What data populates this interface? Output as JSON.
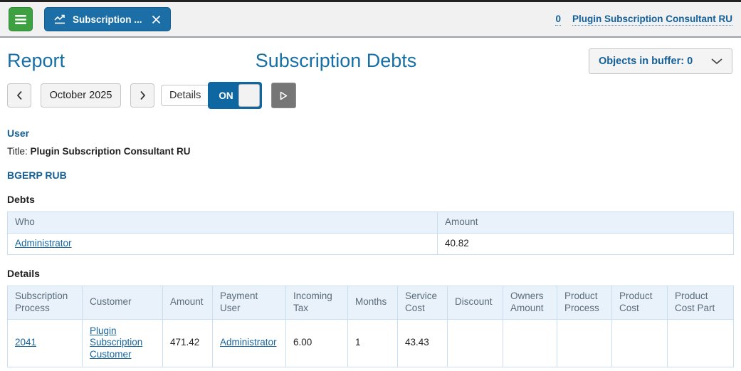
{
  "topbar": {
    "tab_label": "Subscription ...",
    "buffer_link": "0",
    "user_link": "Plugin Subscription Consultant RU"
  },
  "header": {
    "page_title": "Report",
    "report_title": "Subscription Debts",
    "buffer_button_label": "Objects in buffer: 0"
  },
  "toolbar": {
    "month_label": "October 2025",
    "details_label": "Details",
    "toggle_state": "ON"
  },
  "user_section": {
    "heading": "User",
    "title_label": "Title:",
    "title_value": "Plugin Subscription Consultant RU",
    "account_heading": "BGERP RUB"
  },
  "debts": {
    "heading": "Debts",
    "headers": [
      "Who",
      "Amount"
    ],
    "rows": [
      [
        "Administrator",
        "40.82"
      ]
    ]
  },
  "details": {
    "heading": "Details",
    "headers": [
      "Subscription Process",
      "Customer",
      "Amount",
      "Payment User",
      "Incoming Tax",
      "Months",
      "Service Cost",
      "Discount",
      "Owners Amount",
      "Product Process",
      "Product Cost",
      "Product Cost Part"
    ],
    "rows": [
      [
        "2041",
        "Plugin Subscription Customer",
        "471.42",
        "Administrator",
        "6.00",
        "1",
        "43.43",
        "",
        "",
        "",
        "",
        ""
      ]
    ]
  },
  "icons": {
    "menu": "hamburger-icon",
    "tab": "chart-line-icon",
    "tab_close": "close-icon",
    "prev": "chevron-left-icon",
    "next": "chevron-right-icon",
    "buffer_dropdown": "chevron-down-icon",
    "play": "play-icon"
  },
  "colors": {
    "accent_blue": "#176fa5",
    "link_blue": "#17649c",
    "tab_blue": "#1b6ea6",
    "toggle_blue": "#0f67a1",
    "menu_green": "#3da041",
    "table_header_bg": "#e9f2fa",
    "table_border": "#c9def0",
    "table_header_text": "#5b6b7b",
    "play_gray": "#767676"
  }
}
